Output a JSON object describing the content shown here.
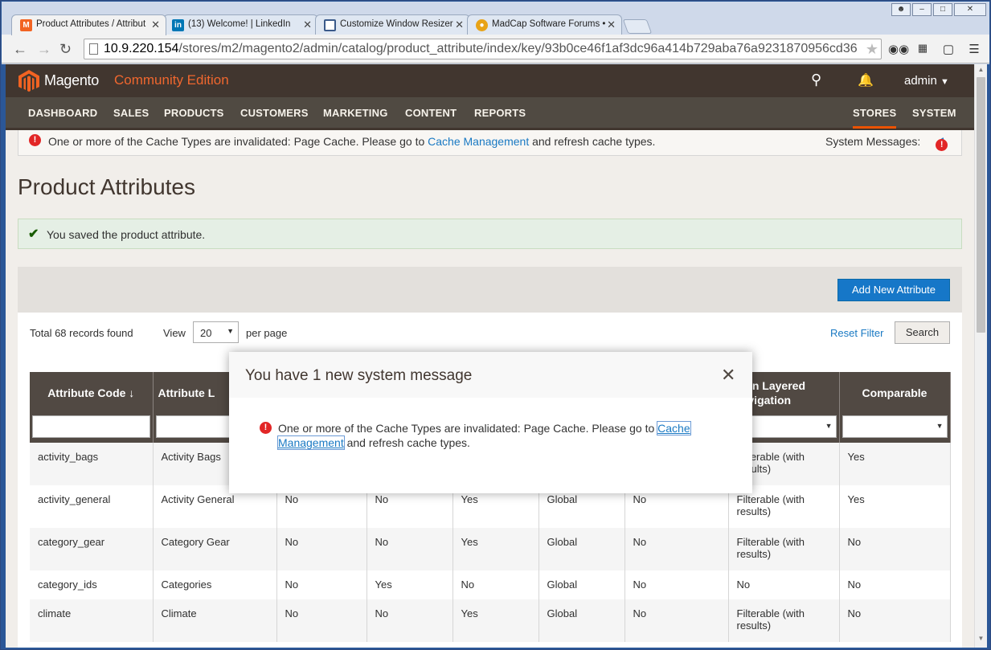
{
  "browser": {
    "tabs": [
      {
        "title": "Product Attributes / Attribut",
        "favicon": "magento-icon",
        "color": "#f26322"
      },
      {
        "title": "(13) Welcome! | LinkedIn",
        "favicon": "linkedin-icon",
        "color": "#0077b5"
      },
      {
        "title": "Customize Window Resizer",
        "favicon": "resizer-icon",
        "color": "#3a5a8a"
      },
      {
        "title": "MadCap Software Forums •",
        "favicon": "madcap-icon",
        "color": "#e8a317"
      }
    ],
    "url_host": "10.9.220.154",
    "url_path": "/stores/m2/magento2/admin/catalog/product_attribute/index/key/93b0ce46f1af3dc96a414b729aba76a9231870956cd36"
  },
  "header": {
    "brand": "Magento",
    "edition": "Community Edition",
    "user": "admin"
  },
  "menu": {
    "items": [
      "DASHBOARD",
      "SALES",
      "PRODUCTS",
      "CUSTOMERS",
      "MARKETING",
      "CONTENT",
      "REPORTS"
    ],
    "right_items": [
      "STORES",
      "SYSTEM"
    ],
    "active": "STORES"
  },
  "system_message": {
    "text_before": "One or more of the Cache Types are invalidated: Page Cache. Please go to ",
    "link": "Cache Management",
    "text_after": " and refresh cache types.",
    "label": "System Messages:",
    "count": "1"
  },
  "page": {
    "title": "Product Attributes",
    "success": "You saved the product attribute.",
    "add_button": "Add New Attribute"
  },
  "grid": {
    "records": "Total 68 records found",
    "view_label": "View",
    "page_size": "20",
    "per_page": "per page",
    "reset_filter": "Reset Filter",
    "search": "Search",
    "columns": [
      "Attribute Code ↓",
      "Attribute L",
      "",
      "",
      "",
      "",
      "",
      "se in Layered Navigation",
      "Comparable"
    ],
    "rows": [
      [
        "activity_bags",
        "Activity Bags",
        "",
        "",
        "",
        "",
        "",
        "Filterable (with results)",
        "Yes"
      ],
      [
        "activity_general",
        "Activity General",
        "No",
        "No",
        "Yes",
        "Global",
        "No",
        "Filterable (with results)",
        "Yes"
      ],
      [
        "category_gear",
        "Category Gear",
        "No",
        "No",
        "Yes",
        "Global",
        "No",
        "Filterable (with results)",
        "No"
      ],
      [
        "category_ids",
        "Categories",
        "No",
        "Yes",
        "No",
        "Global",
        "No",
        "No",
        "No"
      ],
      [
        "climate",
        "Climate",
        "No",
        "No",
        "Yes",
        "Global",
        "No",
        "Filterable (with results)",
        "No"
      ]
    ]
  },
  "modal": {
    "title": "You have 1 new system message",
    "text_before": "One or more of the Cache Types are invalidated: Page Cache. Please go to ",
    "link": "Cache Management",
    "text_after": " and refresh cache types."
  },
  "colors": {
    "header_bg": "#41362f",
    "menu_bg": "#504a42",
    "accent": "#eb5202",
    "edition": "#ef672f",
    "primary_button": "#1677c8",
    "error": "#e22626",
    "success_bg": "#e5efe5"
  }
}
